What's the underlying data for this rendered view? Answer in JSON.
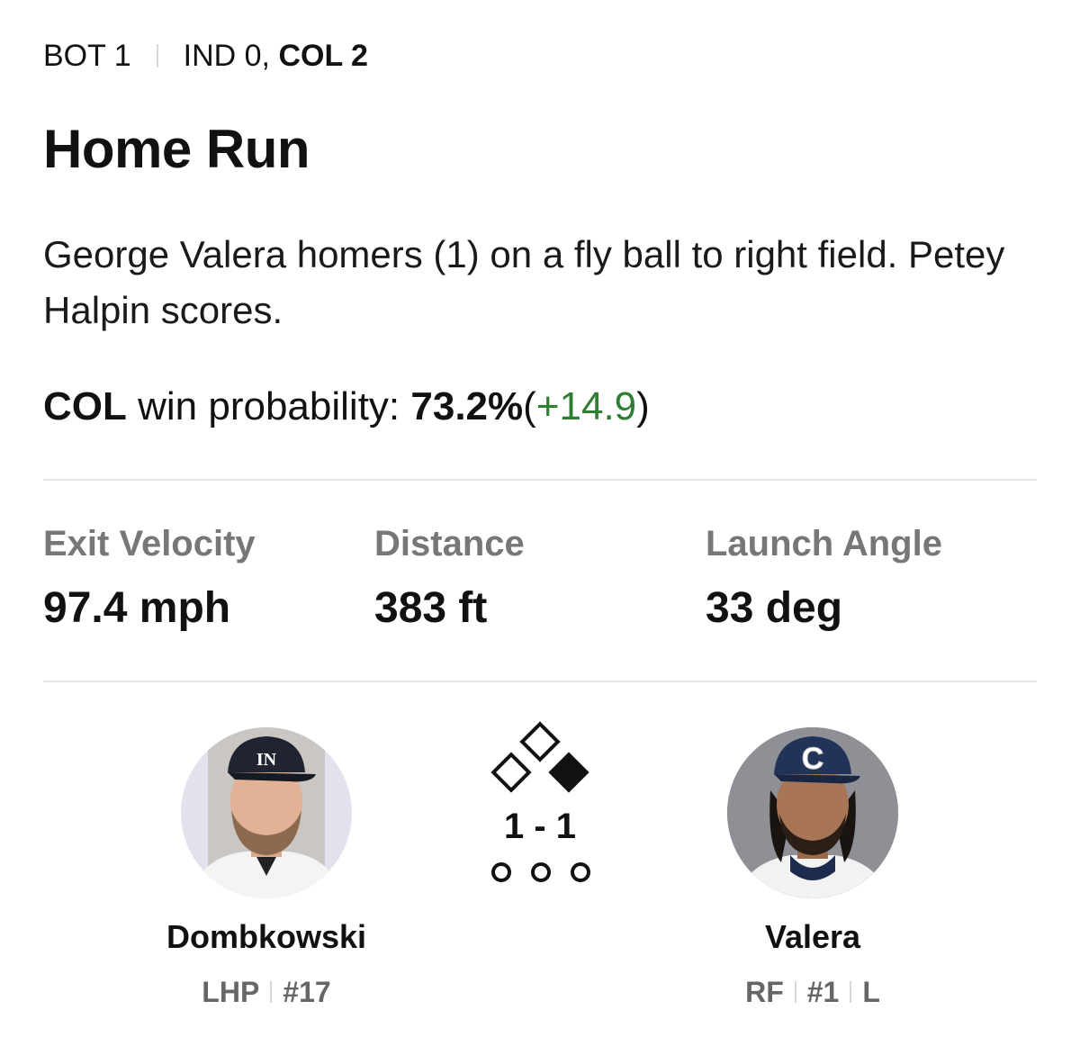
{
  "header": {
    "inning": "BOT 1",
    "away_score": "IND 0,",
    "home_score": "COL 2"
  },
  "play": {
    "title": "Home Run",
    "description": "George Valera homers (1) on a fly ball to right field. Petey Halpin scores."
  },
  "win_probability": {
    "team": "COL",
    "label": "win probability:",
    "value": "73.2%",
    "open_paren": "(",
    "delta": "+14.9",
    "close_paren": ")",
    "delta_color": "#2e7d32"
  },
  "stats": [
    {
      "label": "Exit Velocity",
      "value": "97.4 mph"
    },
    {
      "label": "Distance",
      "value": "383 ft"
    },
    {
      "label": "Launch Angle",
      "value": "33 deg"
    }
  ],
  "pitcher": {
    "name": "Dombkowski",
    "position": "LHP",
    "number": "#17",
    "cap_logo": "IN"
  },
  "batter": {
    "name": "Valera",
    "position": "RF",
    "number": "#1",
    "bats": "L",
    "cap_logo": "C"
  },
  "situation": {
    "count": "1 - 1",
    "bases": {
      "first": false,
      "second": false,
      "third": true
    },
    "outs": 0,
    "base_icon": "bases-diamond-icon",
    "out_icon": "out-indicator-icon"
  }
}
